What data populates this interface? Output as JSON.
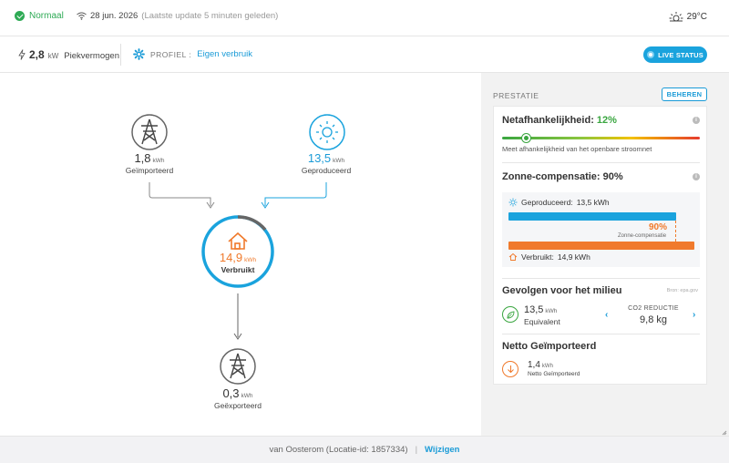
{
  "topbar": {
    "status_label": "Normaal",
    "date": "28 jun. 2026",
    "update_text": "(Laatste update 5 minuten geleden)",
    "temperature": "29°C"
  },
  "subbar": {
    "peak_value": "2,8",
    "peak_unit": "kW",
    "peak_label": "Piekvermogen",
    "profile_label": "PROFIEL :",
    "profile_value": "Eigen verbruik",
    "live_button": "LIVE STATUS"
  },
  "flow": {
    "imported": {
      "value": "1,8",
      "unit": "kWh",
      "label": "Geïmporteerd"
    },
    "produced": {
      "value": "13,5",
      "unit": "kWh",
      "label": "Geproduceerd"
    },
    "consumed": {
      "value": "14,9",
      "unit": "kWh",
      "label": "Verbruikt"
    },
    "exported": {
      "value": "0,3",
      "unit": "kWh",
      "label": "Geëxporteerd"
    }
  },
  "panel": {
    "title": "PRESTATIE",
    "manage_button": "BEHEREN",
    "grid_dependency": {
      "title": "Netafhankelijkheid:",
      "value": "12%",
      "level": 0.12,
      "description": "Meet afhankelijkheid van het openbare stroomnet"
    },
    "solar_compensation": {
      "title": "Zonne-compensatie: 90%",
      "produced_label": "Geproduceerd:",
      "produced_value": "13,5 kWh",
      "percent": "90%",
      "percent_label": "Zonne-compensatie",
      "consumed_label": "Verbruikt:",
      "consumed_value": "14,9 kWh"
    },
    "environment": {
      "title": "Gevolgen voor het milieu",
      "source": "Bron: epa.gov",
      "value": "13,5",
      "unit": "kWh",
      "label": "Equivalent",
      "co2_label": "CO2 REDUCTIE",
      "co2_value": "9,8 kg"
    },
    "net_import": {
      "title": "Netto Geïmporteerd",
      "value": "1,4",
      "unit": "kWh",
      "label": "Netto Geïmporteerd"
    }
  },
  "footer": {
    "location": "van Oosterom (Locatie-id: 1857334)",
    "separator": "|",
    "edit_link": "Wijzigen"
  },
  "colors": {
    "accent_blue": "#1a9bd7",
    "green": "#2eaa55",
    "orange": "#f07a2c"
  }
}
